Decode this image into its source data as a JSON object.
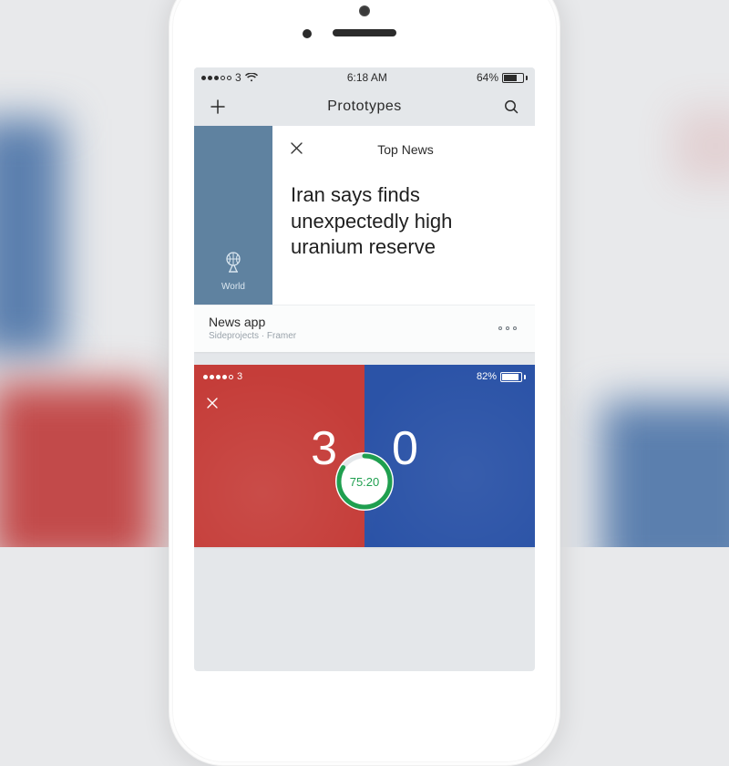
{
  "colors": {
    "accent_blue": "#5f82a0",
    "sports_red": "#c53d39",
    "sports_blue": "#2b53a7",
    "timer_green": "#1f9f4f"
  },
  "statusbar": {
    "carrier": "3",
    "time": "6:18 AM",
    "battery_pct": "64%",
    "battery_fill": 64
  },
  "navbar": {
    "title": "Prototypes"
  },
  "cards": [
    {
      "category_label": "World",
      "section_title": "Top News",
      "headline": "Iran says finds unexpectedly high uranium reserve",
      "footer_title": "News app",
      "footer_sub": "Sideprojects · Framer"
    },
    {
      "inner_status": {
        "carrier": "3",
        "battery_pct": "82%",
        "battery_fill": 82
      },
      "score_left": "3",
      "score_right": "0",
      "timer": "75:20"
    }
  ]
}
